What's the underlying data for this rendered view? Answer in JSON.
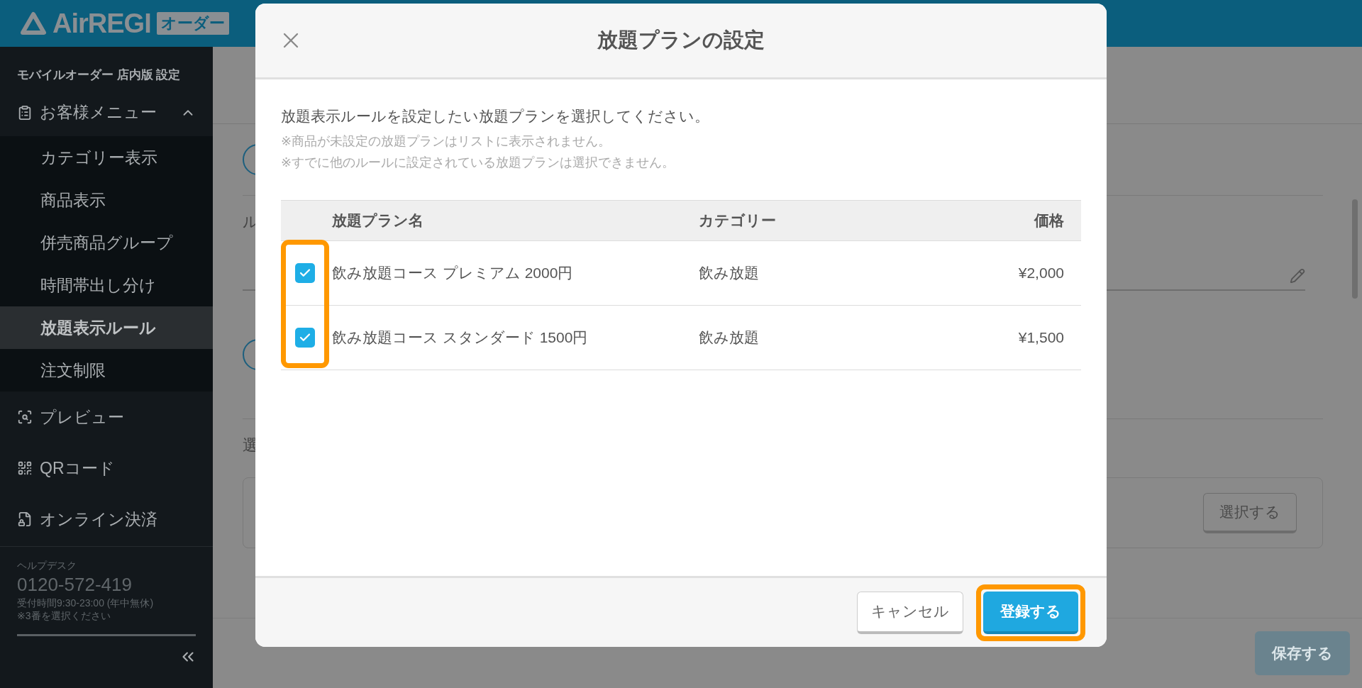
{
  "header": {
    "brand": "AirREGI",
    "badge": "オーダー"
  },
  "sidebar": {
    "section_title": "モバイルオーダー 店内版 設定",
    "menu_group": {
      "label": "お客様メニュー",
      "expanded": true,
      "children": [
        {
          "label": "カテゴリー表示",
          "selected": false
        },
        {
          "label": "商品表示",
          "selected": false
        },
        {
          "label": "併売商品グループ",
          "selected": false
        },
        {
          "label": "時間帯出し分け",
          "selected": false
        },
        {
          "label": "放題表示ルール",
          "selected": true
        },
        {
          "label": "注文制限",
          "selected": false
        }
      ]
    },
    "links": [
      {
        "label": "プレビュー"
      },
      {
        "label": "QRコード"
      },
      {
        "label": "オンライン決済"
      }
    ],
    "helpdesk": {
      "label": "ヘルプデスク",
      "phone": "0120-572-419",
      "hours": "受付時間9:30-23:00 (年中無休)",
      "note": "※3番を選択ください"
    }
  },
  "main": {
    "label_1": "ル",
    "label_2": "選",
    "select_button": "選択する",
    "save_button": "保存する"
  },
  "modal": {
    "title": "放題プランの設定",
    "intro": "放題表示ルールを設定したい放題プランを選択してください。",
    "notes": [
      "※商品が未設定の放題プランはリストに表示されません。",
      "※すでに他のルールに設定されている放題プランは選択できません。"
    ],
    "table": {
      "checkbox_column_highlighted": true,
      "columns": [
        "放題プラン名",
        "カテゴリー",
        "価格"
      ],
      "rows": [
        {
          "checked": true,
          "name": "飲み放題コース プレミアム 2000円",
          "category": "飲み放題",
          "price": "¥2,000"
        },
        {
          "checked": true,
          "name": "飲み放題コース スタンダード 1500円",
          "category": "飲み放題",
          "price": "¥1,500"
        }
      ]
    },
    "cancel_button": "キャンセル",
    "submit_button": {
      "label": "登録する",
      "highlighted": true
    }
  }
}
